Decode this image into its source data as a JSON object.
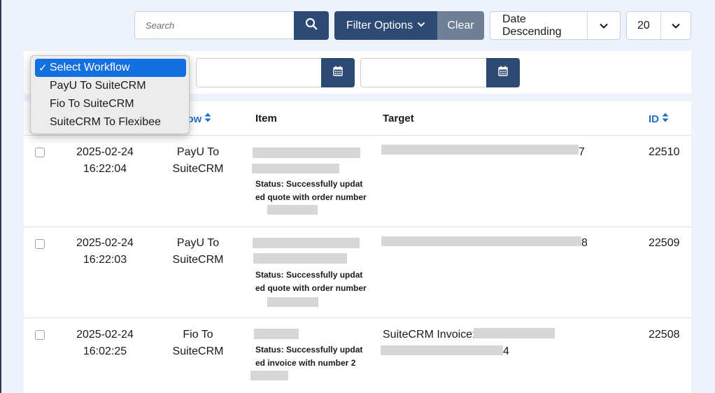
{
  "toolbar": {
    "search_placeholder": "Search",
    "filter_label": "Filter Options",
    "clear_label": "Clear",
    "sort_value": "Date Descending",
    "page_size": "20"
  },
  "workflow_dropdown": {
    "options": [
      "Select Workflow",
      "PayU To SuiteCRM",
      "Fio To SuiteCRM",
      "SuiteCRM To Flexibee"
    ],
    "selected_index": 0,
    "check": "✓"
  },
  "table": {
    "headers": {
      "workflow": "kflow",
      "item": "Item",
      "target": "Target",
      "id": "ID"
    },
    "rows": [
      {
        "date": "2025-02-24",
        "time": "16:22:04",
        "workflow_line1": "PayU To",
        "workflow_line2": "SuiteCRM",
        "status": "Status: Successfully updated quote with order number",
        "target_suffix": "7",
        "id": "22510"
      },
      {
        "date": "2025-02-24",
        "time": "16:22:03",
        "workflow_line1": "PayU To",
        "workflow_line2": "SuiteCRM",
        "status": "Status: Successfully updated quote with order number",
        "target_suffix": "8",
        "id": "22509"
      },
      {
        "date": "2025-02-24",
        "time": "16:02:25",
        "workflow_line1": "Fio To",
        "workflow_line2": "SuiteCRM",
        "status": "Status: Successfully updated invoice with number 2",
        "target_prefix": "SuiteCRM Invoice:",
        "target_suffix": "4",
        "id": "22508"
      }
    ]
  },
  "colors": {
    "primary": "#2c4a74",
    "secondary": "#6e7f96",
    "link": "#1f6fc4",
    "selection": "#1470de",
    "background": "#eef2fa"
  }
}
